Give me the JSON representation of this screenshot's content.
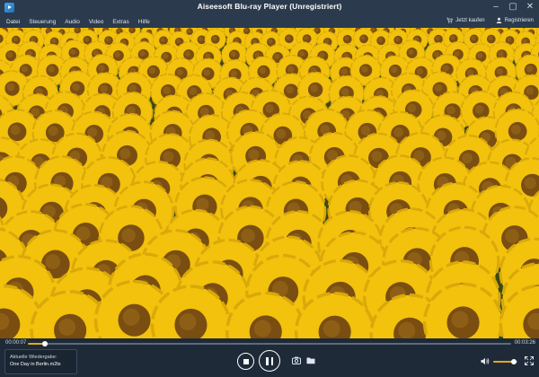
{
  "window": {
    "title": "Aiseesoft Blu-ray Player (Unregistriert)",
    "controls": {
      "minimize": "–",
      "restore": "▢",
      "close": "✕"
    }
  },
  "menu": {
    "items": [
      {
        "label": "Datei"
      },
      {
        "label": "Steuerung"
      },
      {
        "label": "Audio"
      },
      {
        "label": "Video"
      },
      {
        "label": "Extras"
      },
      {
        "label": "Hilfe"
      }
    ],
    "buy_label": "Jetzt kaufen",
    "register_label": "Registrieren"
  },
  "player": {
    "current_time": "00:00:07",
    "total_time": "00:03:26",
    "progress": 0.035,
    "volume": 0.85,
    "now_playing_label": "Aktuelle Wiedergabe:",
    "now_playing_file": "One Day in Berlin.m2ts"
  },
  "colors": {
    "accent": "#e6a817",
    "chrome": "#2b3a4c",
    "control_bg": "#1e2a38",
    "petal": "#f2c20c",
    "center": "#7a4e10"
  },
  "icons": {
    "app": "app-logo-icon",
    "cart": "cart-icon",
    "user": "user-icon",
    "stop": "stop-icon",
    "pause": "pause-icon",
    "snapshot": "camera-icon",
    "open": "folder-icon",
    "volume": "speaker-icon",
    "fullscreen": "fullscreen-icon"
  }
}
